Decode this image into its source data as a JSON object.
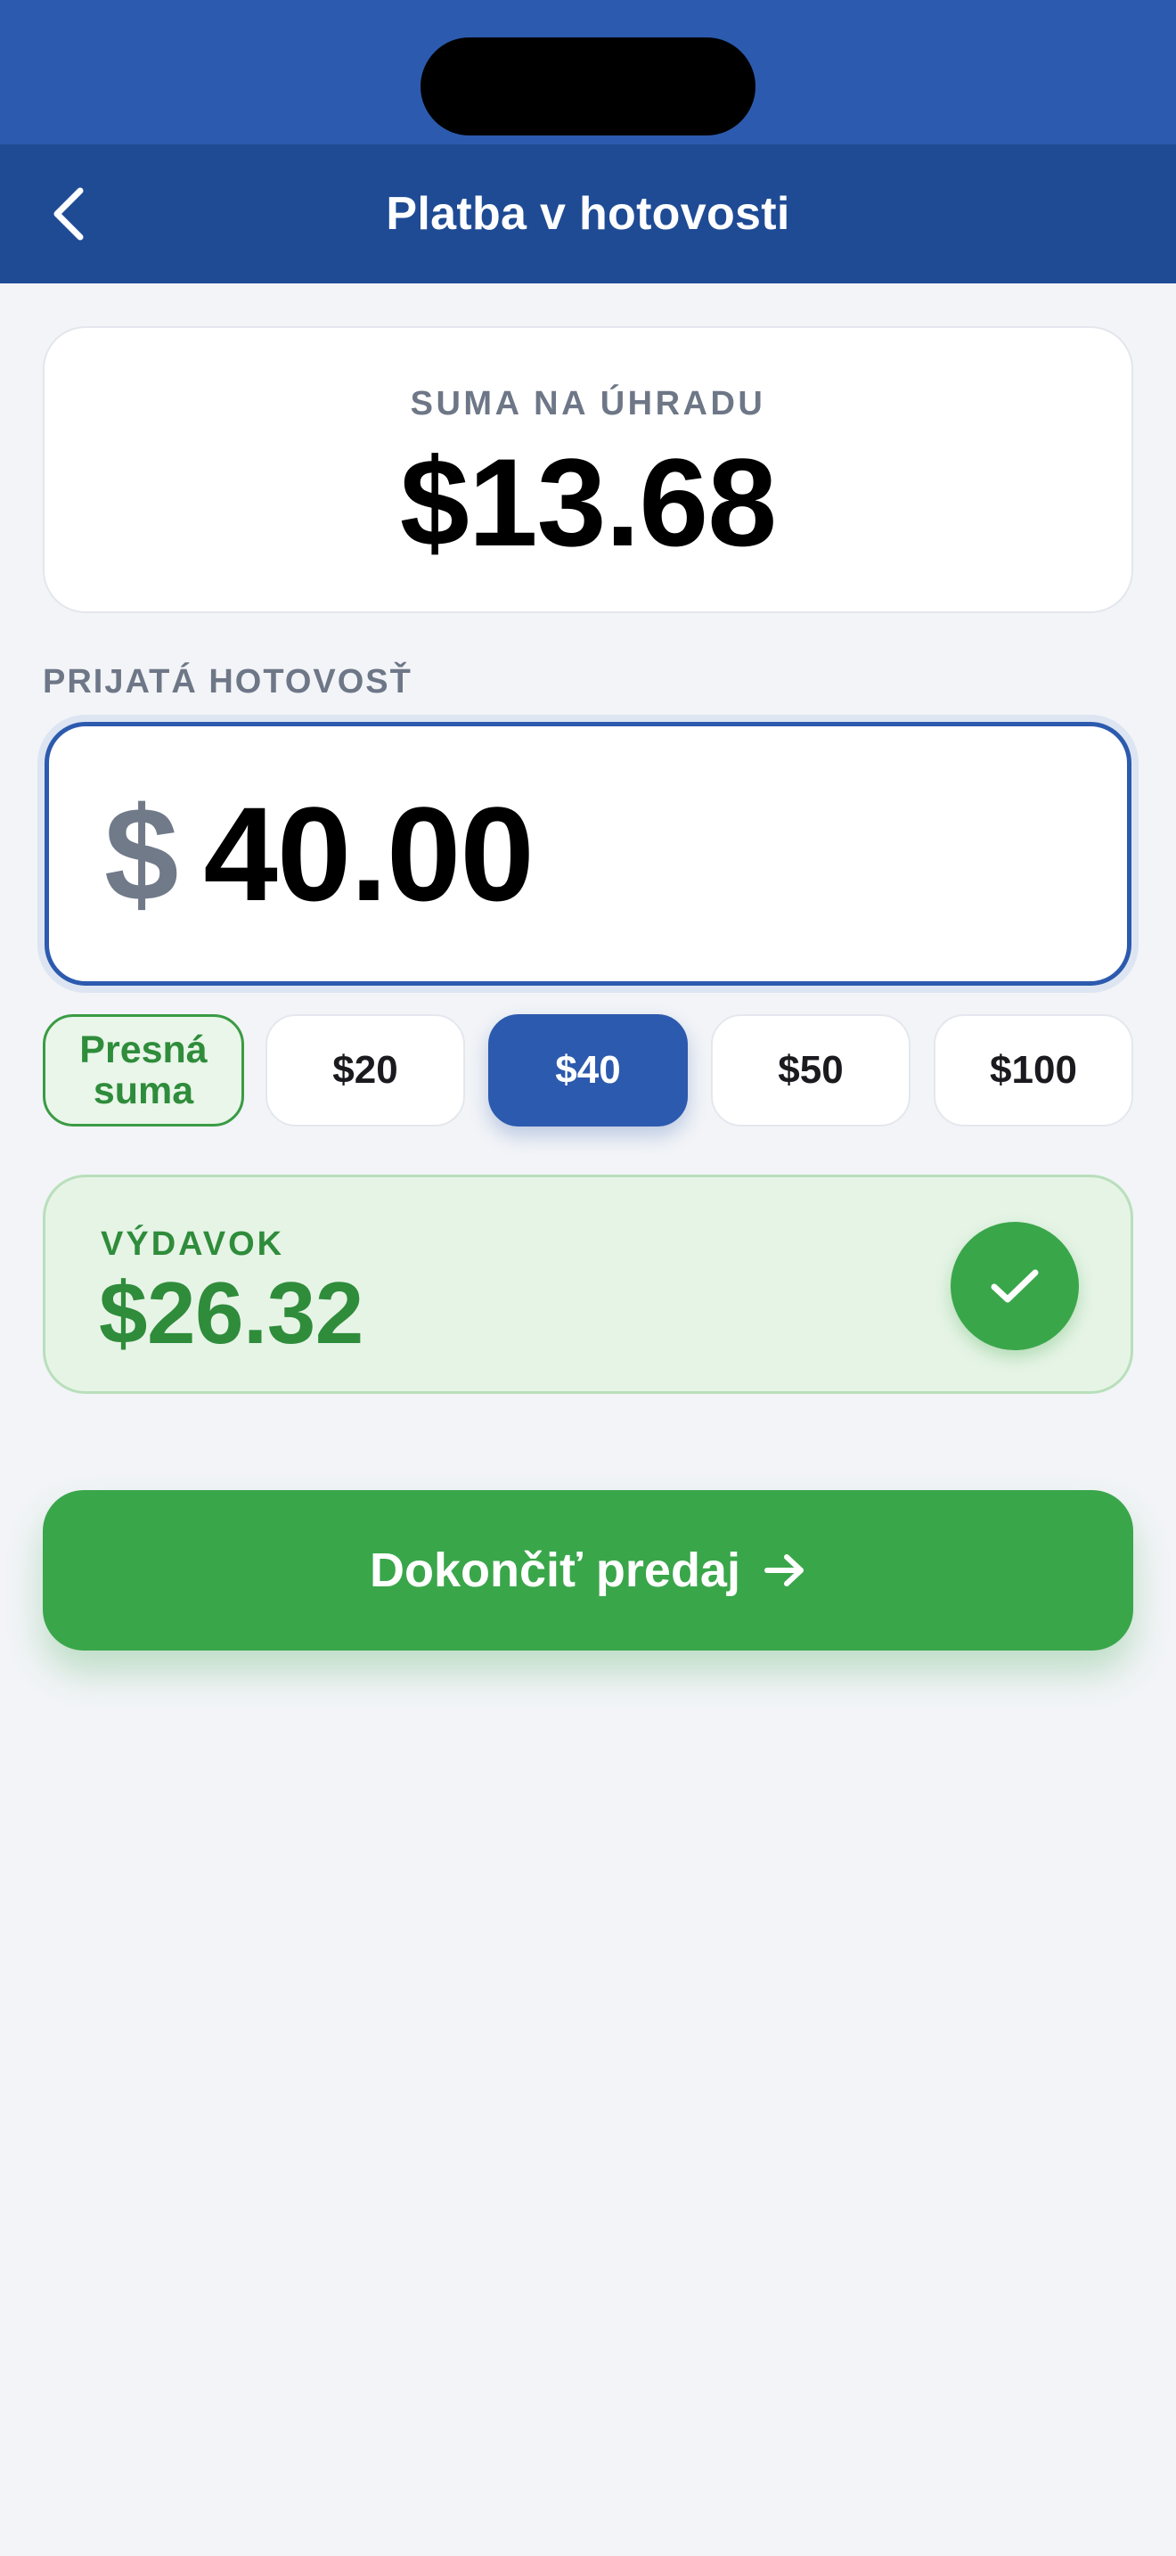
{
  "header": {
    "title": "Platba v hotovosti",
    "back_icon": "chevron-left-icon",
    "bar_color": "#1f4b95",
    "status_color": "#2c5aae"
  },
  "amount_due": {
    "label": "SUMA NA ÚHRADU",
    "value": "$13.68"
  },
  "cash_received": {
    "label": "PRIJATÁ HOTOVOSŤ",
    "currency": "$",
    "value": "40.00"
  },
  "quick_amounts": {
    "exact_line1": "Presná",
    "exact_line2": "suma",
    "options": [
      "$20",
      "$40",
      "$50",
      "$100"
    ],
    "selected": "$40"
  },
  "change": {
    "label": "VÝDAVOK",
    "value": "$26.32",
    "status_icon": "check-icon",
    "color": "#2f8c3b"
  },
  "finish": {
    "label": "Dokončiť predaj",
    "icon": "arrow-right-icon",
    "color": "#3aa64a"
  }
}
